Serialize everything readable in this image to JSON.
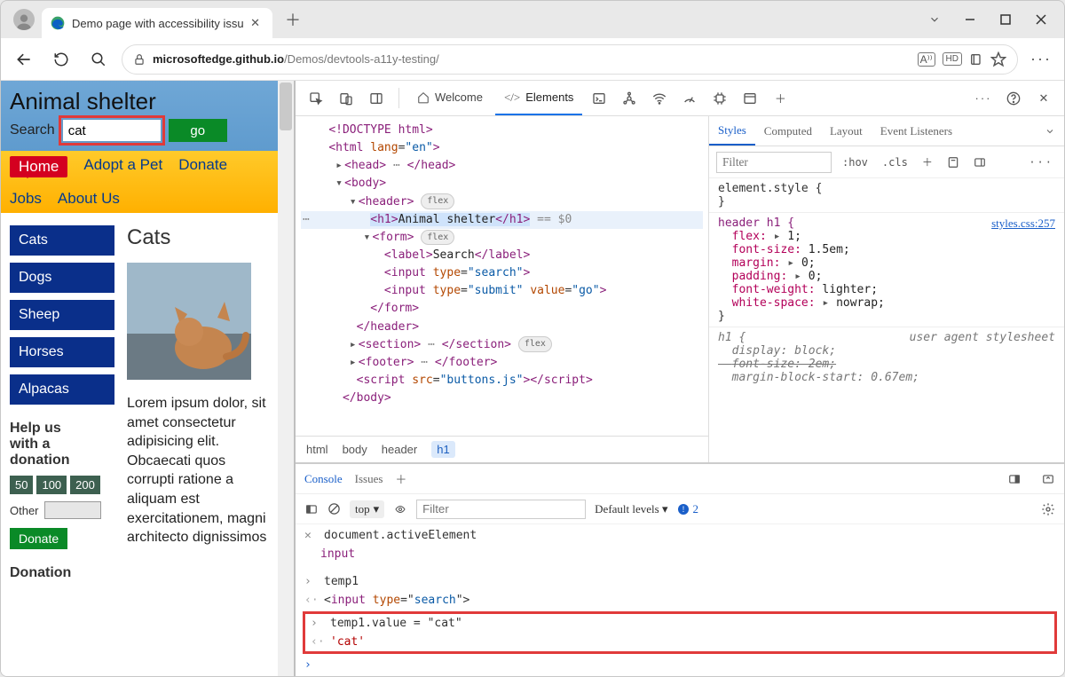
{
  "browser": {
    "tab_title": "Demo page with accessibility issu",
    "url_domain": "microsoftedge.github.io",
    "url_path": "/Demos/devtools-a11y-testing/"
  },
  "demo": {
    "title": "Animal shelter",
    "search_label": "Search",
    "search_value": "cat",
    "go_label": "go",
    "nav": {
      "home": "Home",
      "adopt": "Adopt a Pet",
      "donate": "Donate",
      "jobs": "Jobs",
      "about": "About Us"
    },
    "side_links": [
      "Cats",
      "Dogs",
      "Sheep",
      "Horses",
      "Alpacas"
    ],
    "help_heading_l1": "Help us",
    "help_heading_l2": "with a",
    "help_heading_l3": "donation",
    "chips": [
      "50",
      "100",
      "200"
    ],
    "other_label": "Other",
    "donate_btn": "Donate",
    "donation_heading": "Donation",
    "main_heading": "Cats",
    "lorem": "Lorem ipsum dolor, sit amet consectetur adipisicing elit. Obcaecati quos corrupti ratione a aliquam est exercitationem, magni architecto dignissimos"
  },
  "devtools": {
    "tabs": {
      "welcome": "Welcome",
      "elements": "Elements"
    },
    "dom": {
      "l_doctype": "<!DOCTYPE html>",
      "l_head_open": "<head>",
      "l_head_ell": "…",
      "l_head_close": "</head>",
      "l_h1_inner": "Animal shelter",
      "l_h1_eq": " == $0",
      "l_label_inner": "Search",
      "l_script_src": "buttons.js"
    },
    "breadcrumb": [
      "html",
      "body",
      "header",
      "h1"
    ],
    "styles": {
      "tabs": {
        "styles": "Styles",
        "computed": "Computed",
        "layout": "Layout",
        "event": "Event Listeners"
      },
      "filter_ph": "Filter",
      "hov": ":hov",
      "cls": ".cls",
      "element_style": "element.style {",
      "close_brace": "}",
      "header_sel": "header h1 {",
      "link": "styles.css:257",
      "p_flex": "flex:",
      "v_flex": "1;",
      "p_fs": "font-size:",
      "v_fs": "1.5em;",
      "p_margin": "margin:",
      "v_margin": "0;",
      "p_padding": "padding:",
      "v_padding": "0;",
      "p_fw": "font-weight:",
      "v_fw": "lighter;",
      "p_ws": "white-space:",
      "v_ws": "nowrap;",
      "h1_sel": "h1 {",
      "ua_label": "user agent stylesheet",
      "p_disp": "display:",
      "v_disp": "block;",
      "p_fs2": "font-size: 2em;",
      "p_mbs": "margin-block-start: 0.67em;"
    },
    "drawer": {
      "tabs": {
        "console": "Console",
        "issues": "Issues"
      },
      "ctx": "top",
      "filter_ph": "Filter",
      "levels": "Default levels",
      "issue_count": "2",
      "r1": "document.activeElement",
      "r1_out": "input",
      "r2": "temp1",
      "r2_out_pre": "    <",
      "r2_out_tag": "input ",
      "r2_out_attr": "type",
      "r2_out_eq": "=\"",
      "r2_out_val": "search",
      "r2_out_post": "\">",
      "r3": "temp1.value = \"cat\"",
      "r3_out": "'cat'"
    }
  }
}
